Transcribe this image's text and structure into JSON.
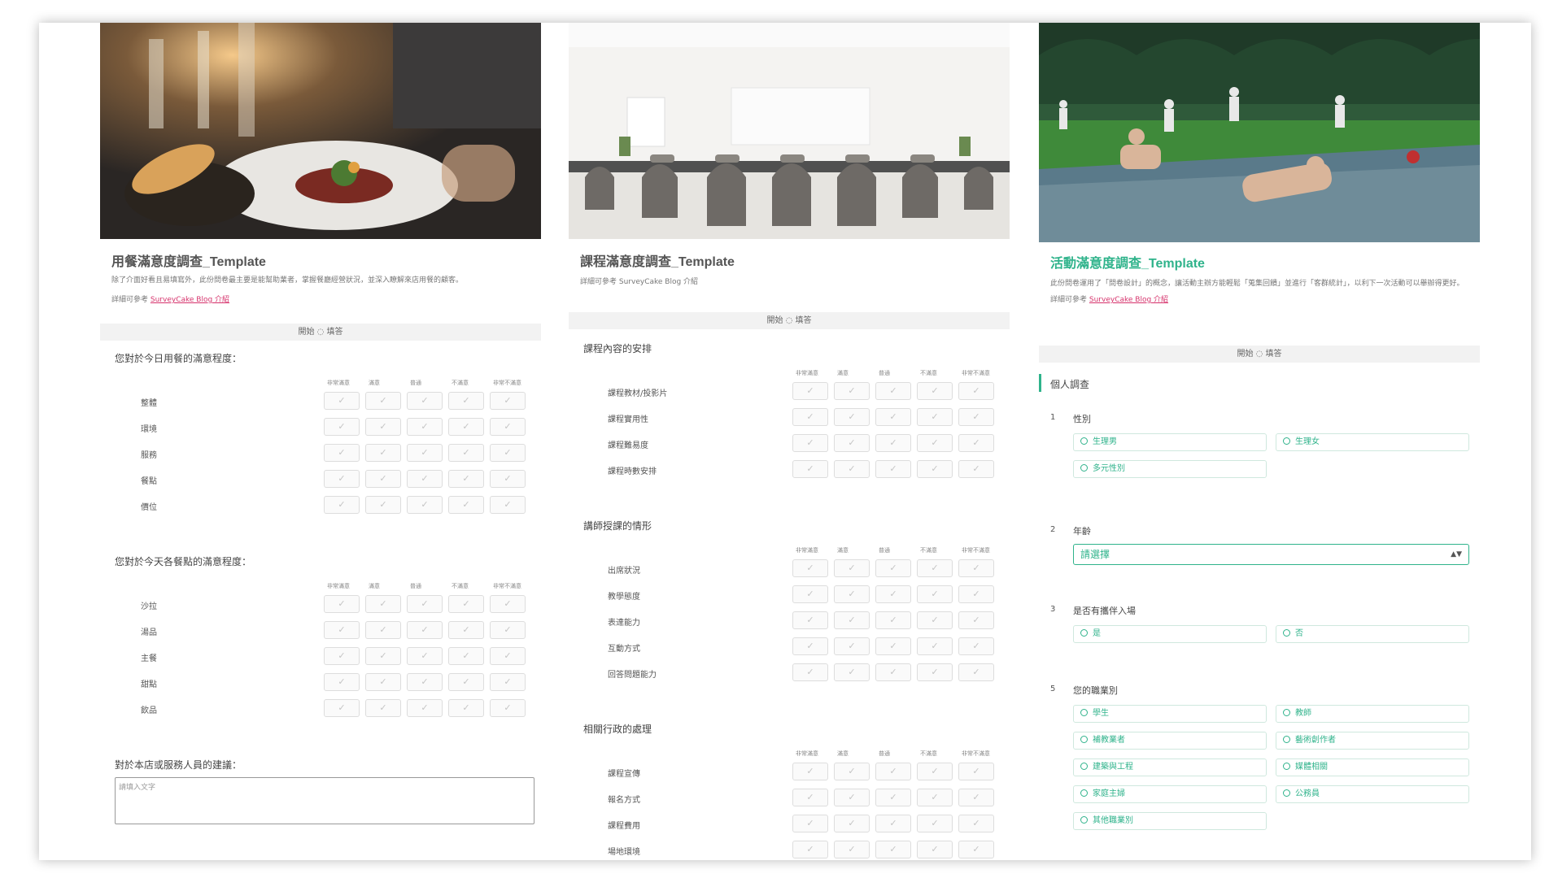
{
  "panels": [
    {
      "title": "用餐滿意度調查_Template",
      "description": "除了介面好看且易填寫外，此份問卷最主要是能幫助業者，掌握餐廳經營狀況，並深入瞭解來店用餐的顧客。",
      "ref_prefix": "詳細可參考",
      "ref_link": "SurveyCake Blog 介紹",
      "start_label": "開始 ◌ 填答",
      "matrix_columns": [
        "非常滿意",
        "滿意",
        "普通",
        "不滿意",
        "非常不滿意"
      ],
      "questions": [
        {
          "title": "您對於今日用餐的滿意程度：",
          "rows": [
            "整體",
            "環境",
            "服務",
            "餐點",
            "價位"
          ]
        },
        {
          "title": "您對於今天各餐點的滿意程度：",
          "rows": [
            "沙拉",
            "湯品",
            "主餐",
            "甜點",
            "飲品"
          ]
        }
      ],
      "text_question": "對於本店或服務人員的建議：",
      "text_placeholder": "請填入文字"
    },
    {
      "title": "課程滿意度調查_Template",
      "ref_prefix": "詳細可參考",
      "ref_link": "SurveyCake Blog 介紹",
      "start_label": "開始 ◌ 填答",
      "matrix_columns": [
        "非常滿意",
        "滿意",
        "普通",
        "不滿意",
        "非常不滿意"
      ],
      "questions": [
        {
          "title": "課程內容的安排",
          "rows": [
            "課程教材/投影片",
            "課程實用性",
            "課程難易度",
            "課程時數安排"
          ]
        },
        {
          "title": "講師授課的情形",
          "rows": [
            "出席狀況",
            "教學態度",
            "表達能力",
            "互動方式",
            "回答問題能力"
          ]
        },
        {
          "title": "相關行政的處理",
          "rows": [
            "課程宣傳",
            "報名方式",
            "課程費用",
            "場地環境"
          ]
        }
      ]
    },
    {
      "title": "活動滿意度調查_Template",
      "description": "此份問卷運用了「問卷設計」的概念，讓活動主辦方能輕鬆「蒐集回饋」並進行「客群統計」，以利下一次活動可以舉辦得更好。",
      "ref_prefix": "詳細可參考",
      "ref_link": "SurveyCake Blog 介紹",
      "start_label": "開始 ◌ 填答",
      "section": "個人調查",
      "q1": {
        "num": "1",
        "label": "性別",
        "options": [
          "生理男",
          "生理女",
          "多元性別"
        ]
      },
      "q2": {
        "num": "2",
        "label": "年齡",
        "select_value": "請選擇"
      },
      "q3": {
        "num": "3",
        "label": "是否有攜伴入場",
        "options": [
          "是",
          "否"
        ]
      },
      "q5": {
        "num": "5",
        "label": "您的職業別",
        "options": [
          "學生",
          "教師",
          "補教業者",
          "藝術創作者",
          "建築與工程",
          "媒體相關",
          "家庭主婦",
          "公務員",
          "其他職業別"
        ]
      }
    }
  ],
  "colors": {
    "accent": "#2fb38b",
    "link": "#d6336c"
  }
}
